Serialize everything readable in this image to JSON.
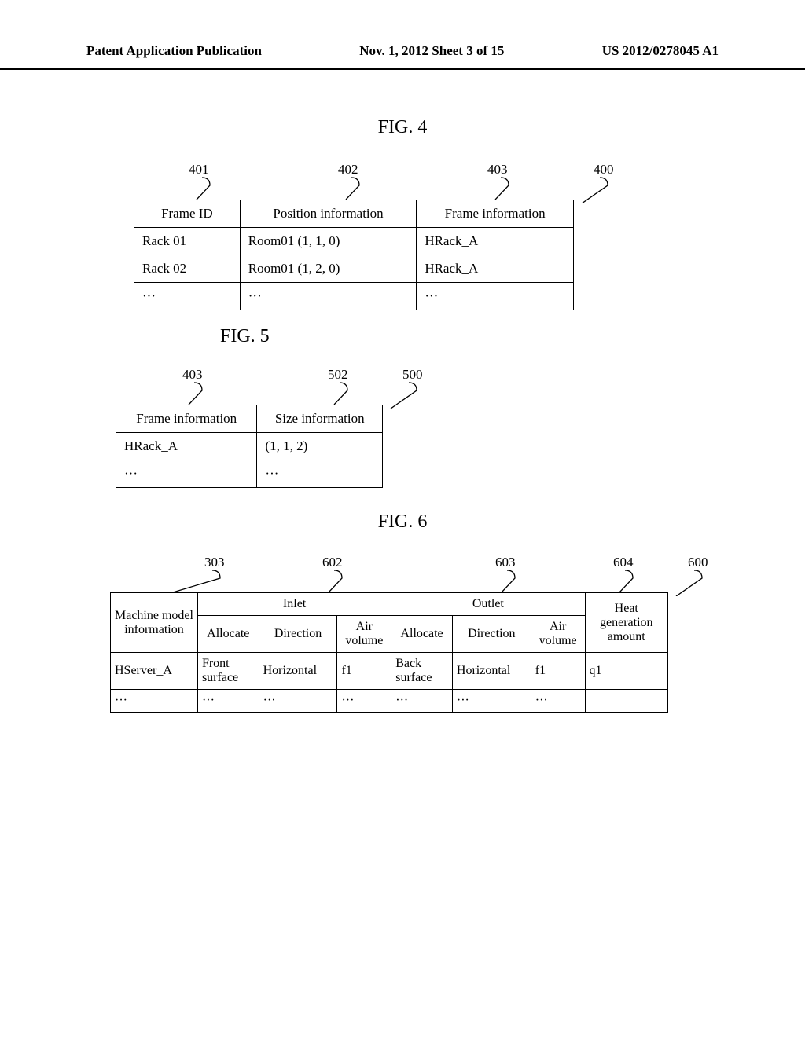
{
  "header": {
    "left": "Patent Application Publication",
    "center": "Nov. 1, 2012   Sheet 3 of 15",
    "right": "US 2012/0278045 A1"
  },
  "fig4": {
    "title": "FIG. 4",
    "refs": {
      "c1": "401",
      "c2": "402",
      "c3": "403",
      "table": "400"
    },
    "headers": {
      "c1": "Frame ID",
      "c2": "Position information",
      "c3": "Frame information"
    },
    "rows": [
      {
        "c1": "Rack 01",
        "c2": "Room01 (1, 1, 0)",
        "c3": "HRack_A"
      },
      {
        "c1": "Rack 02",
        "c2": "Room01 (1, 2, 0)",
        "c3": "HRack_A"
      },
      {
        "c1": "···",
        "c2": "···",
        "c3": "···"
      }
    ]
  },
  "fig5": {
    "title": "FIG. 5",
    "refs": {
      "c1": "403",
      "c2": "502",
      "table": "500"
    },
    "headers": {
      "c1": "Frame information",
      "c2": "Size information"
    },
    "rows": [
      {
        "c1": "HRack_A",
        "c2": "(1, 1, 2)"
      },
      {
        "c1": "···",
        "c2": "···"
      }
    ]
  },
  "fig6": {
    "title": "FIG. 6",
    "refs": {
      "c1": "303",
      "c2": "602",
      "c3": "603",
      "c4": "604",
      "table": "600"
    },
    "headers": {
      "c1": "Machine model information",
      "inlet": "Inlet",
      "outlet": "Outlet",
      "heat": "Heat generation amount",
      "allocate": "Allocate",
      "direction": "Direction",
      "air": "Air volume"
    },
    "rows": [
      {
        "c1": "HServer_A",
        "in_alloc": "Front surface",
        "in_dir": "Horizontal",
        "in_air": "f1",
        "out_alloc": "Back surface",
        "out_dir": "Horizontal",
        "out_air": "f1",
        "heat": "q1"
      },
      {
        "c1": "···",
        "in_alloc": "···",
        "in_dir": "···",
        "in_air": "···",
        "out_alloc": "···",
        "out_dir": "···",
        "out_air": "···",
        "heat": ""
      }
    ]
  }
}
